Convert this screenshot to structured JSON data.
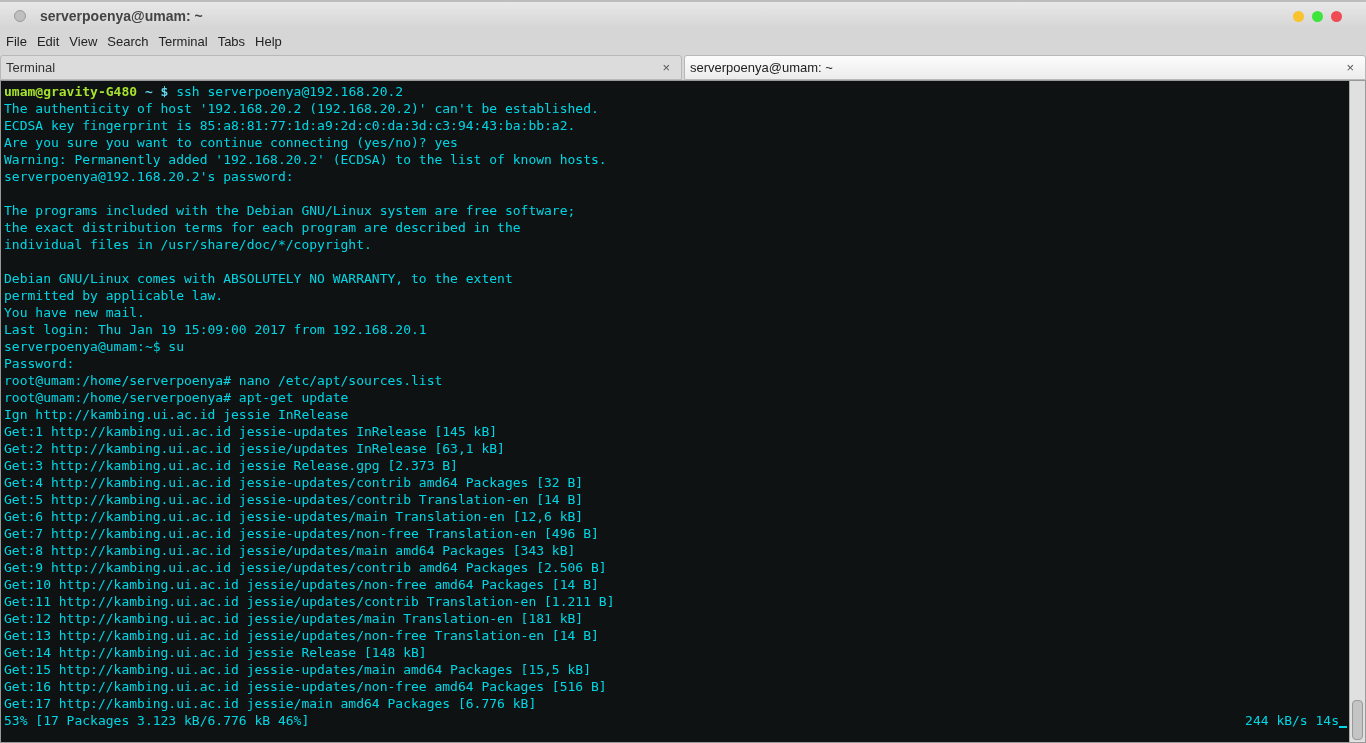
{
  "window": {
    "title": "serverpoenya@umam: ~"
  },
  "menu": [
    "File",
    "Edit",
    "View",
    "Search",
    "Terminal",
    "Tabs",
    "Help"
  ],
  "tabs": [
    {
      "label": "Terminal",
      "selected": false,
      "close": "×"
    },
    {
      "label": "serverpoenya@umam: ~",
      "selected": true,
      "close": "×"
    }
  ],
  "terminal": {
    "lines": [
      {
        "kind": "prompt",
        "user": "umam@gravity-G480",
        "path": "~ $",
        "command": "ssh serverpoenya@192.168.20.2"
      },
      {
        "kind": "output",
        "text": "The authenticity of host '192.168.20.2 (192.168.20.2)' can't be established."
      },
      {
        "kind": "output",
        "text": "ECDSA key fingerprint is 85:a8:81:77:1d:a9:2d:c0:da:3d:c3:94:43:ba:bb:a2."
      },
      {
        "kind": "output",
        "text": "Are you sure you want to continue connecting (yes/no)? yes"
      },
      {
        "kind": "output",
        "text": "Warning: Permanently added '192.168.20.2' (ECDSA) to the list of known hosts."
      },
      {
        "kind": "output",
        "text": "serverpoenya@192.168.20.2's password:"
      },
      {
        "kind": "blank"
      },
      {
        "kind": "output",
        "text": "The programs included with the Debian GNU/Linux system are free software;"
      },
      {
        "kind": "output",
        "text": "the exact distribution terms for each program are described in the"
      },
      {
        "kind": "output",
        "text": "individual files in /usr/share/doc/*/copyright."
      },
      {
        "kind": "blank"
      },
      {
        "kind": "output",
        "text": "Debian GNU/Linux comes with ABSOLUTELY NO WARRANTY, to the extent"
      },
      {
        "kind": "output",
        "text": "permitted by applicable law."
      },
      {
        "kind": "output",
        "text": "You have new mail."
      },
      {
        "kind": "output",
        "text": "Last login: Thu Jan 19 15:09:00 2017 from 192.168.20.1"
      },
      {
        "kind": "output",
        "text": "serverpoenya@umam:~$ su"
      },
      {
        "kind": "output",
        "text": "Password:"
      },
      {
        "kind": "output",
        "text": "root@umam:/home/serverpoenya# nano /etc/apt/sources.list"
      },
      {
        "kind": "output",
        "text": "root@umam:/home/serverpoenya# apt-get update"
      },
      {
        "kind": "output",
        "text": "Ign http://kambing.ui.ac.id jessie InRelease"
      },
      {
        "kind": "output",
        "text": "Get:1 http://kambing.ui.ac.id jessie-updates InRelease [145 kB]"
      },
      {
        "kind": "output",
        "text": "Get:2 http://kambing.ui.ac.id jessie/updates InRelease [63,1 kB]"
      },
      {
        "kind": "output",
        "text": "Get:3 http://kambing.ui.ac.id jessie Release.gpg [2.373 B]"
      },
      {
        "kind": "output",
        "text": "Get:4 http://kambing.ui.ac.id jessie-updates/contrib amd64 Packages [32 B]"
      },
      {
        "kind": "output",
        "text": "Get:5 http://kambing.ui.ac.id jessie-updates/contrib Translation-en [14 B]"
      },
      {
        "kind": "output",
        "text": "Get:6 http://kambing.ui.ac.id jessie-updates/main Translation-en [12,6 kB]"
      },
      {
        "kind": "output",
        "text": "Get:7 http://kambing.ui.ac.id jessie-updates/non-free Translation-en [496 B]"
      },
      {
        "kind": "output",
        "text": "Get:8 http://kambing.ui.ac.id jessie/updates/main amd64 Packages [343 kB]"
      },
      {
        "kind": "output",
        "text": "Get:9 http://kambing.ui.ac.id jessie/updates/contrib amd64 Packages [2.506 B]"
      },
      {
        "kind": "output",
        "text": "Get:10 http://kambing.ui.ac.id jessie/updates/non-free amd64 Packages [14 B]"
      },
      {
        "kind": "output",
        "text": "Get:11 http://kambing.ui.ac.id jessie/updates/contrib Translation-en [1.211 B]"
      },
      {
        "kind": "output",
        "text": "Get:12 http://kambing.ui.ac.id jessie/updates/main Translation-en [181 kB]"
      },
      {
        "kind": "output",
        "text": "Get:13 http://kambing.ui.ac.id jessie/updates/non-free Translation-en [14 B]"
      },
      {
        "kind": "output",
        "text": "Get:14 http://kambing.ui.ac.id jessie Release [148 kB]"
      },
      {
        "kind": "output",
        "text": "Get:15 http://kambing.ui.ac.id jessie-updates/main amd64 Packages [15,5 kB]"
      },
      {
        "kind": "output",
        "text": "Get:16 http://kambing.ui.ac.id jessie-updates/non-free amd64 Packages [516 B]"
      },
      {
        "kind": "output",
        "text": "Get:17 http://kambing.ui.ac.id jessie/main amd64 Packages [6.776 kB]"
      }
    ],
    "status": {
      "progress": "53% [17 Packages 3.123 kB/6.776 kB 46%]",
      "rate": "244 kB/s 14s"
    }
  }
}
